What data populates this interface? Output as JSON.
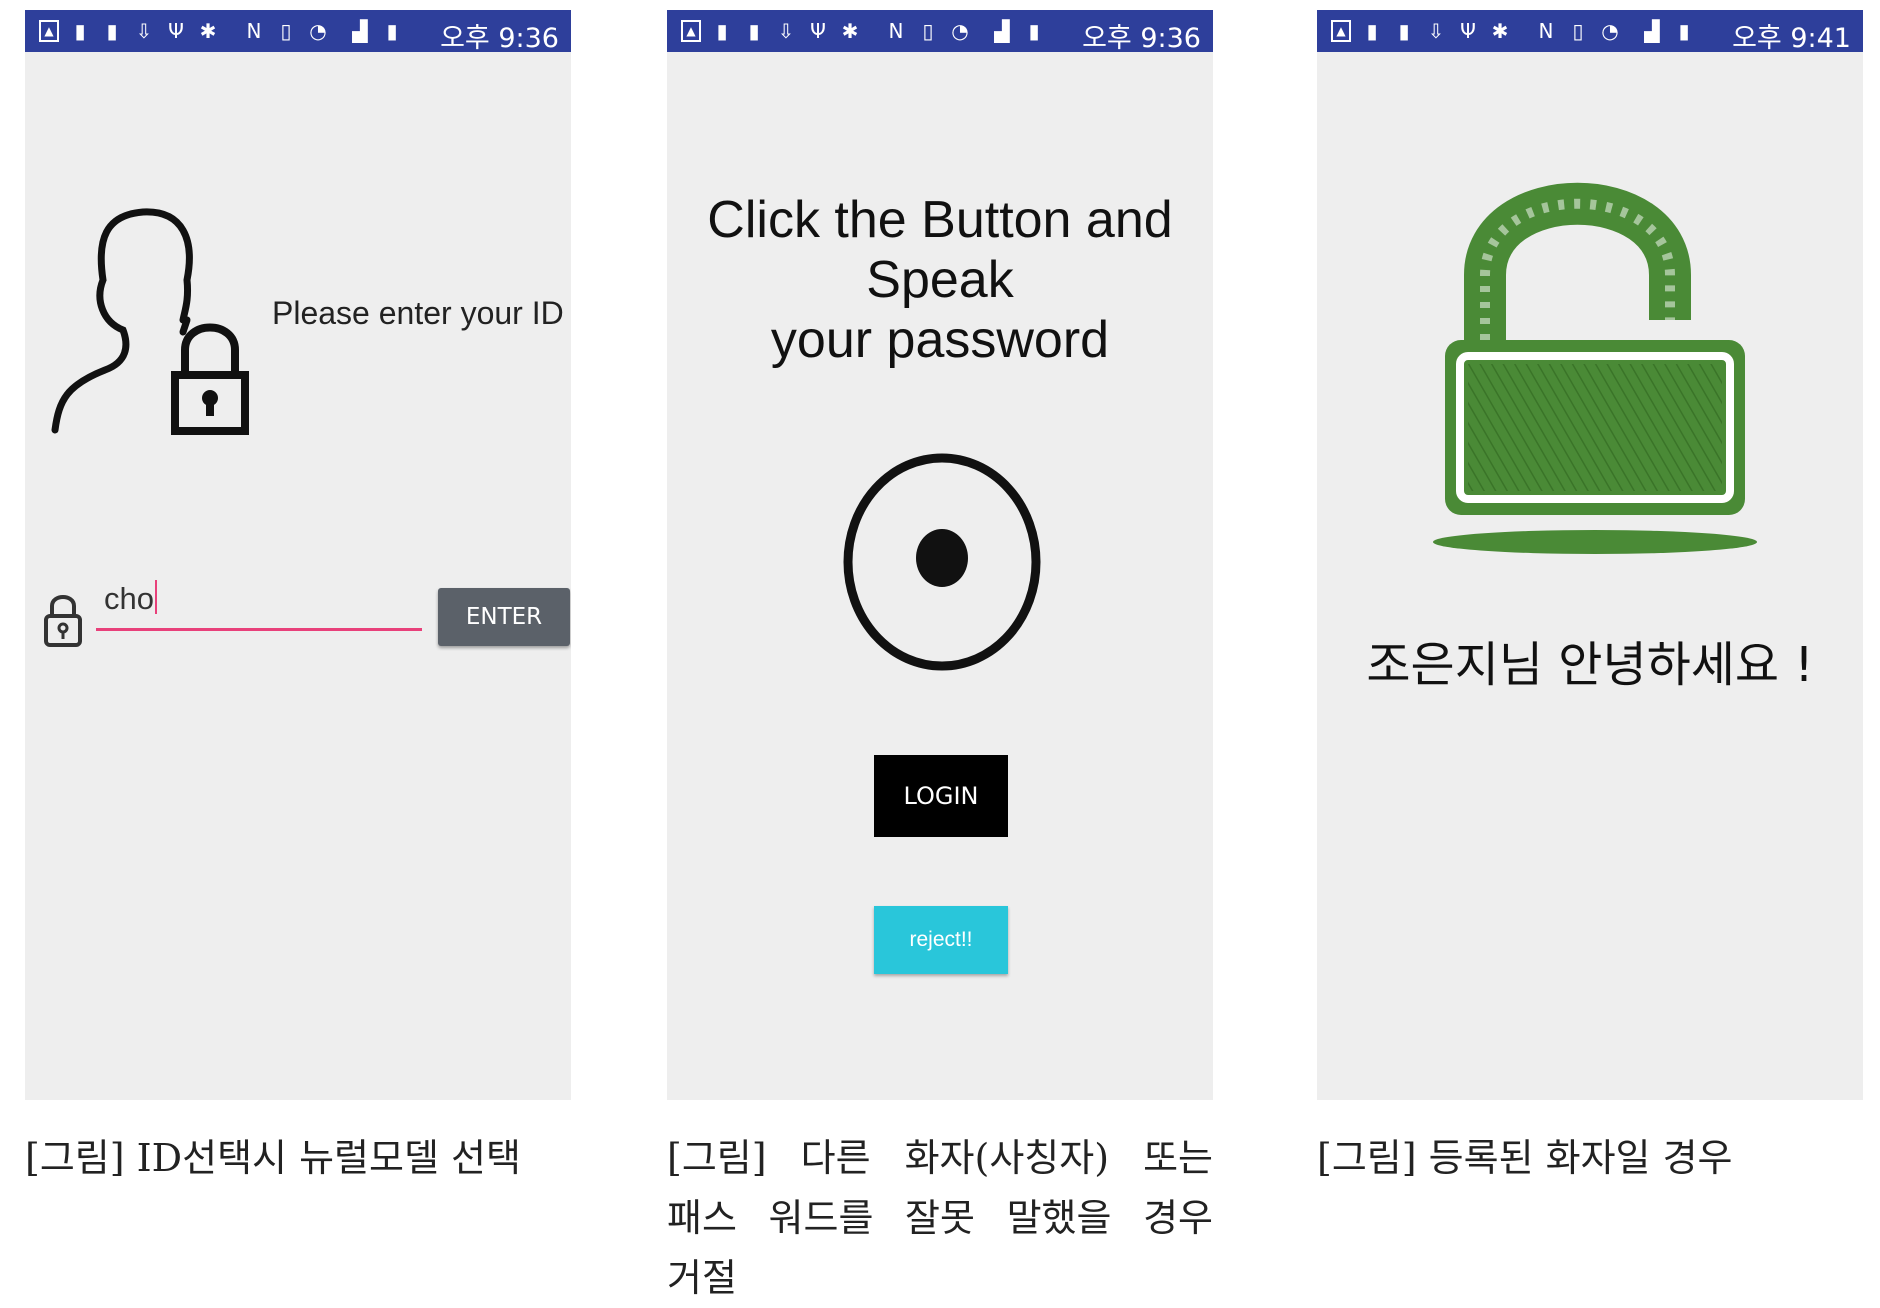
{
  "screens": [
    {
      "status": {
        "time": "오후 9:36"
      },
      "prompt": "Please enter your ID",
      "id_input_value": "cho",
      "enter_button": "ENTER"
    },
    {
      "status": {
        "time": "오후 9:36"
      },
      "title_line1": "Click the Button and Speak",
      "title_line2": "your password",
      "login_button": "LOGIN",
      "reject_button": "reject!!"
    },
    {
      "status": {
        "time": "오후 9:41"
      },
      "greeting": "조은지님 안녕하세요 !"
    }
  ],
  "captions": {
    "screen1": "[그림] ID선택시 뉴럴모델 선택",
    "screen2_line1": "[그림] 다른 화자(사칭자) 또는",
    "screen2_line2": "패스 워드를 잘못 말했을 경우",
    "screen2_line3": "거절",
    "screen3": "[그림] 등록된 화자일 경우"
  },
  "colors": {
    "status_bar": "#2e3f9b",
    "screen_bg": "#eeeeee",
    "input_underline": "#e8407a",
    "enter_button": "#5b6169",
    "login_button": "#000000",
    "reject_button": "#29c6da",
    "lock_green": "#4a8a36"
  },
  "icons": [
    "image-icon",
    "battery-saver-icon",
    "sd-card-icon",
    "download-icon",
    "usb-icon",
    "bug-icon",
    "nfc-icon",
    "vibrate-icon",
    "wifi-icon",
    "signal-icon",
    "battery-icon",
    "user-lock-icon",
    "padlock-icon",
    "record-icon",
    "unlocked-padlock-icon"
  ]
}
